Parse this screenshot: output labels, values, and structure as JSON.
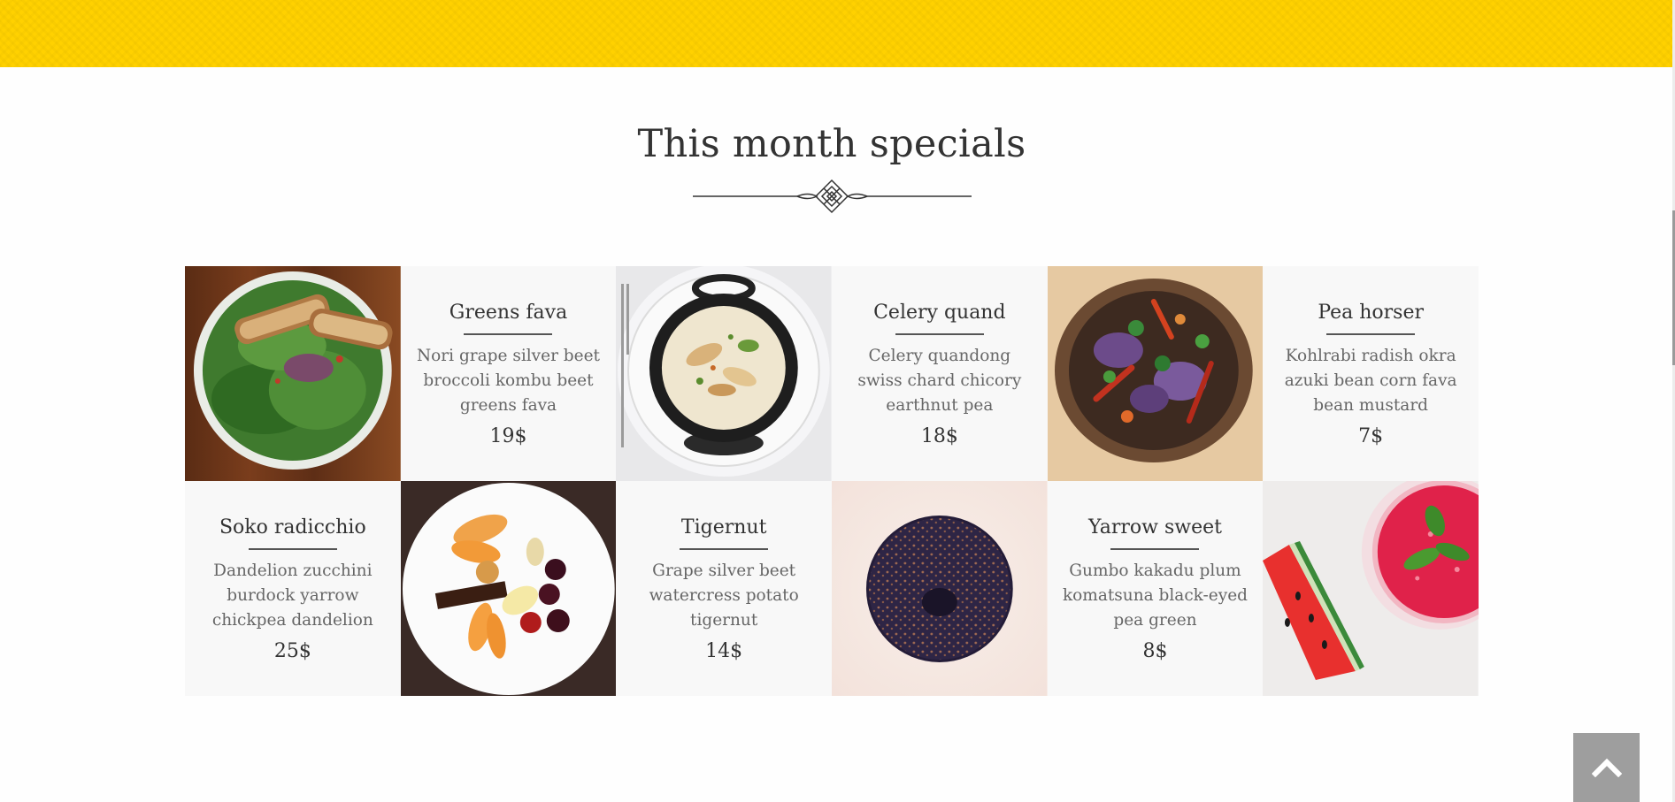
{
  "section": {
    "title": "This month specials"
  },
  "menu": {
    "items": [
      {
        "name": "Greens fava",
        "description": "Nori grape silver beet broccoli kombu beet greens fava",
        "price": "19$"
      },
      {
        "name": "Celery quand",
        "description": "Celery quandong swiss chard chicory earthnut pea",
        "price": "18$"
      },
      {
        "name": "Pea horser",
        "description": "Kohlrabi radish okra azuki bean corn fava bean mustard",
        "price": "7$"
      },
      {
        "name": "Soko radicchio",
        "description": "Dandelion zucchini burdock yarrow chickpea dandelion",
        "price": "25$"
      },
      {
        "name": "Tigernut",
        "description": "Grape silver beet watercress potato tigernut",
        "price": "14$"
      },
      {
        "name": "Yarrow sweet",
        "description": "Gumbo kakadu plum komatsuna black-eyed pea green",
        "price": "8$"
      }
    ],
    "photos": [
      {
        "subject": "salad-with-bread"
      },
      {
        "subject": "creamy-dish-in-pot"
      },
      {
        "subject": "vegetable-bowl"
      },
      {
        "subject": "dessert-plate"
      },
      {
        "subject": "chocolate-donut"
      },
      {
        "subject": "watermelon-drink"
      }
    ]
  },
  "colors": {
    "topbar": "#ffd100",
    "card_bg": "#f8f8f8",
    "back_to_top": "#9e9e9e"
  },
  "icons": {
    "back_to_top": "chevron-up-icon",
    "divider": "ornament-divider-icon"
  }
}
